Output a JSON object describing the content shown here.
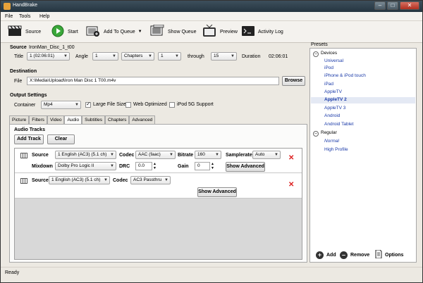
{
  "window": {
    "title": "HandBrake",
    "minimize": "–",
    "maximize": "□",
    "close": "✕"
  },
  "menu": [
    "File",
    "Tools",
    "Help"
  ],
  "toolbar": {
    "source": "Source",
    "start": "Start",
    "add_to_queue": "Add To Queue",
    "show_queue": "Show Queue",
    "preview": "Preview",
    "activity_log": "Activity Log"
  },
  "source": {
    "heading": "Source",
    "name": "IronMan_Disc_1_t00",
    "title_label": "Title",
    "title_value": "1 (02:06:01)",
    "angle_label": "Angle",
    "angle_value": "1",
    "range_type": "Chapters",
    "range_from": "1",
    "through_label": "through",
    "range_to": "15",
    "duration_label": "Duration",
    "duration_value": "02:06:01"
  },
  "destination": {
    "heading": "Destination",
    "file_label": "File",
    "file_value": "X:\\Media\\Upload\\Iron Man Disc 1 T00.m4v",
    "browse": "Browse"
  },
  "output": {
    "heading": "Output Settings",
    "container_label": "Container",
    "container_value": "Mp4",
    "large_file": "Large File Size",
    "web_optimized": "Web Optimized",
    "ipod_5g": "iPod 5G Support"
  },
  "tabs": [
    "Picture",
    "Filters",
    "Video",
    "Audio",
    "Subtitles",
    "Chapters",
    "Advanced"
  ],
  "audio": {
    "heading": "Audio Tracks",
    "add_track": "Add Track",
    "clear": "Clear",
    "track1": {
      "source_label": "Source",
      "source_value": "1 English (AC3) (5.1 ch)",
      "codec_label": "Codec",
      "codec_value": "AAC (faac)",
      "bitrate_label": "Bitrate",
      "bitrate_value": "160",
      "samplerate_label": "Samplerate",
      "samplerate_value": "Auto",
      "mixdown_label": "Mixdown",
      "mixdown_value": "Dolby Pro Logic II",
      "drc_label": "DRC",
      "drc_value": "0.0",
      "gain_label": "Gain",
      "gain_value": "0",
      "show_advanced": "Show Advanced"
    },
    "track2": {
      "source_label": "Source",
      "source_value": "1 English (AC3) (5.1 ch)",
      "codec_label": "Codec",
      "codec_value": "AC3 Passthru",
      "show_advanced": "Show Advanced"
    }
  },
  "presets": {
    "heading": "Presets",
    "devices_group": "Devices",
    "devices": [
      "Universal",
      "iPod",
      "iPhone & iPod touch",
      "iPad",
      "AppleTV",
      "AppleTV 2",
      "AppleTV 3",
      "Android",
      "Android Tablet"
    ],
    "selected": "AppleTV 2",
    "regular_group": "Regular",
    "regular": [
      "Normal",
      "High Profile"
    ],
    "add": "Add",
    "remove": "Remove",
    "options": "Options"
  },
  "status": "Ready"
}
